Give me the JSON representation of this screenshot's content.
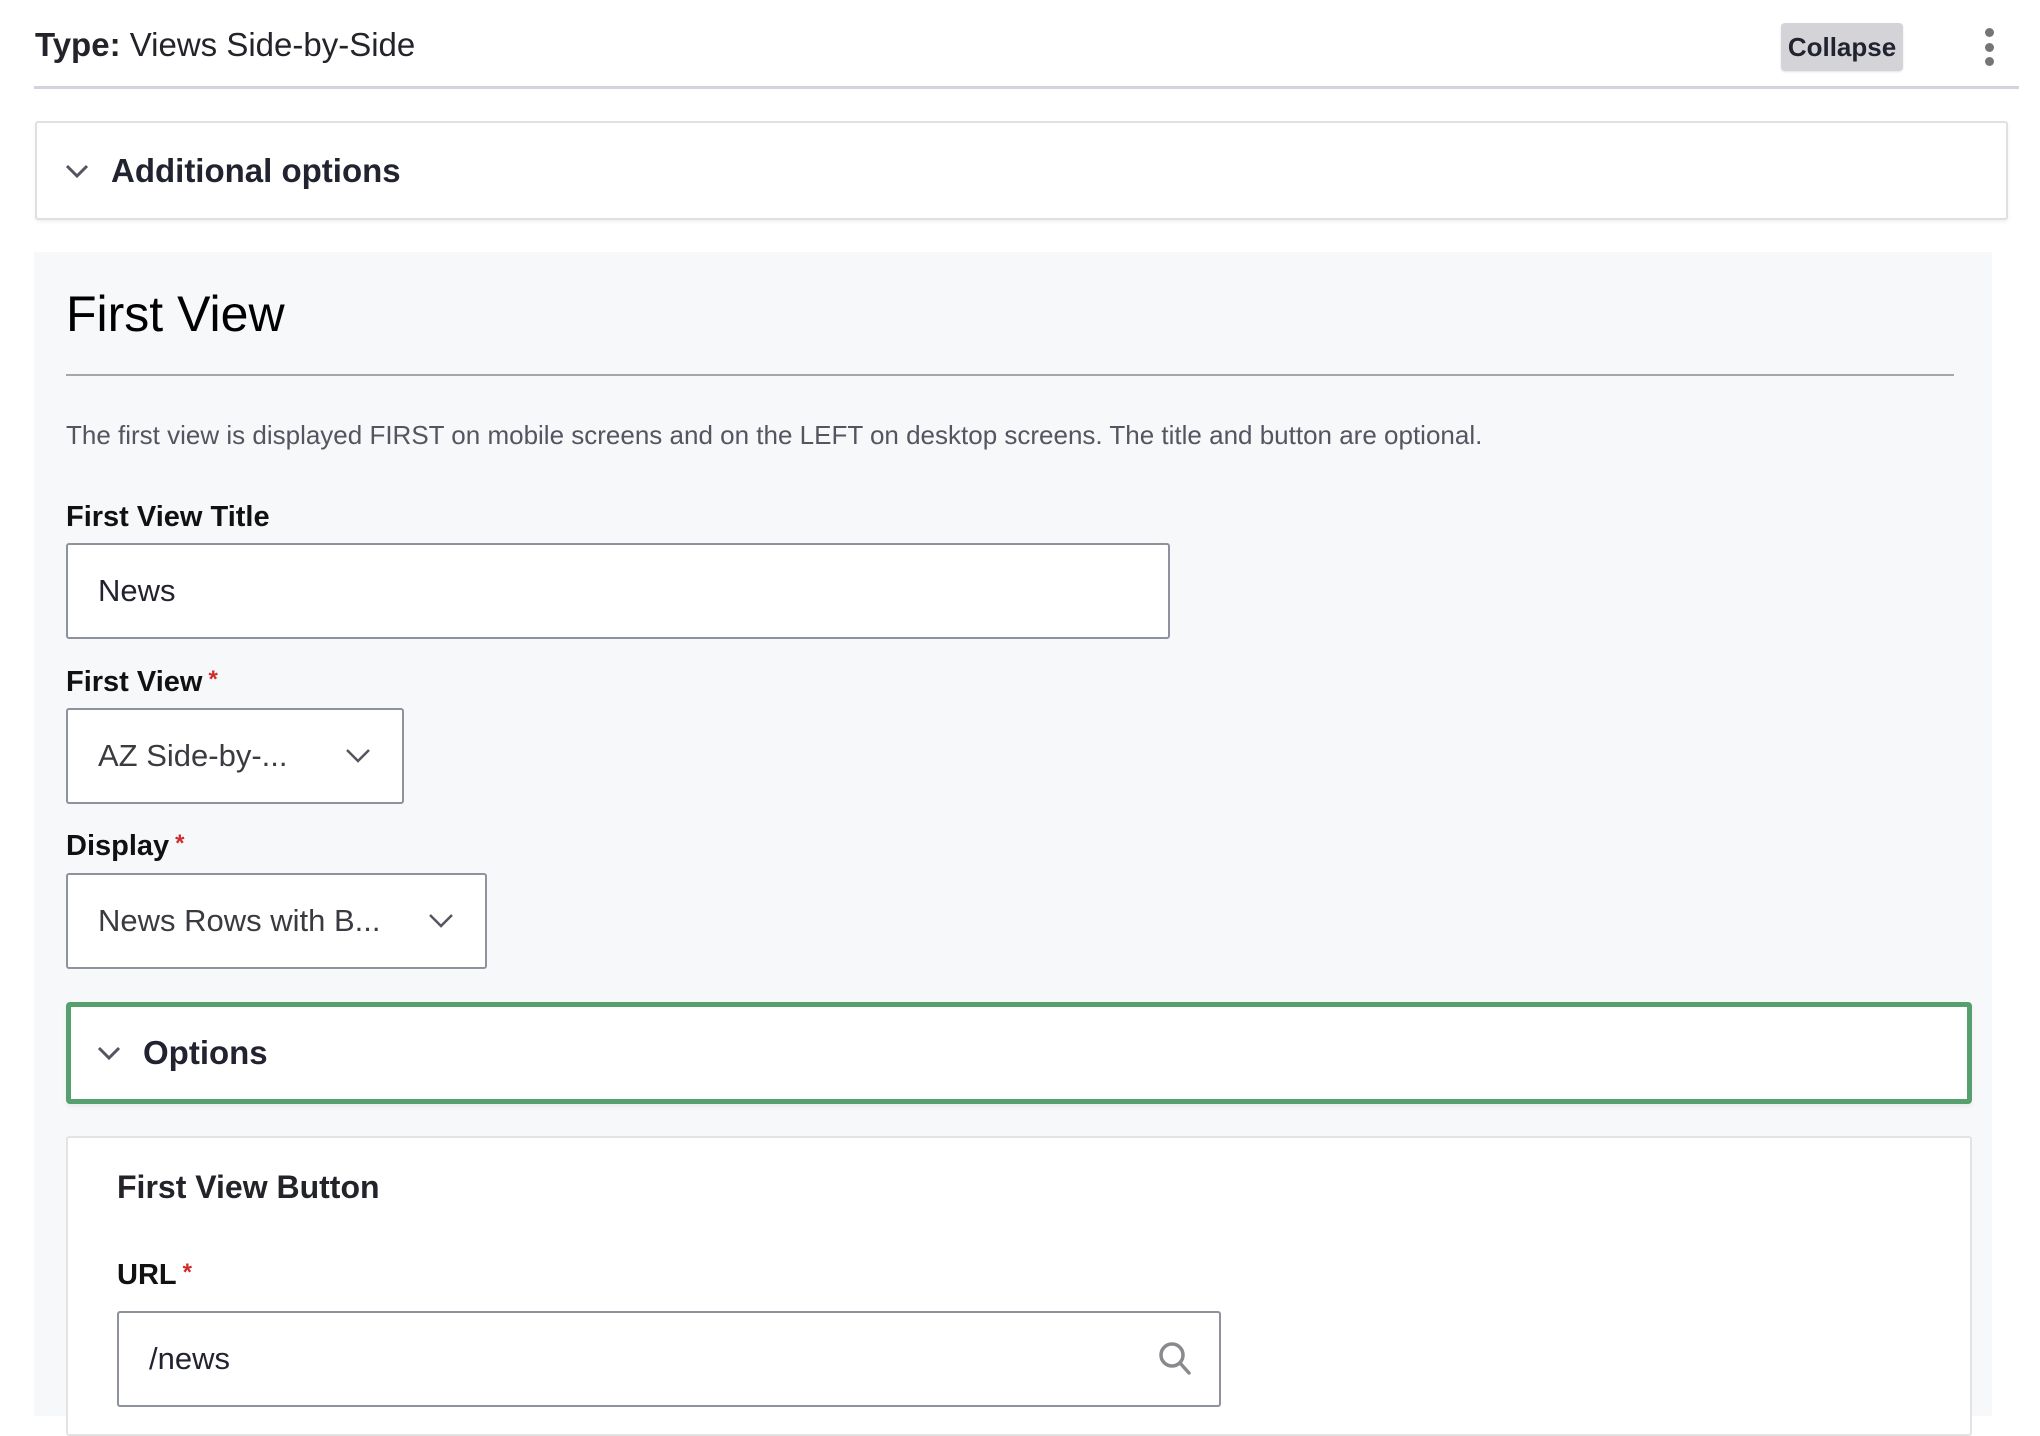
{
  "header": {
    "type_label": "Type:",
    "type_value": "Views Side-by-Side",
    "collapse_button": "Collapse",
    "more_icon": "kebab-vertical-icon"
  },
  "additional_options": {
    "label": "Additional options",
    "icon": "chevron-down-icon"
  },
  "first_view_panel": {
    "heading": "First View",
    "description": "The first view is displayed FIRST on mobile screens and on the LEFT on desktop screens. The title and button are optional.",
    "title_field": {
      "label": "First View Title",
      "value": "News"
    },
    "view_select": {
      "label": "First View",
      "required_marker": "*",
      "selected": "AZ Side-by-..."
    },
    "display_select": {
      "label": "Display",
      "required_marker": "*",
      "selected": "News Rows with B..."
    },
    "options_toggle": {
      "label": "Options",
      "icon": "chevron-down-icon"
    },
    "button_group": {
      "heading": "First View Button",
      "url_field": {
        "label": "URL",
        "required_marker": "*",
        "value": "/news",
        "icon": "search-icon"
      }
    }
  },
  "colors": {
    "focus_border": "#55a06e",
    "required": "#d02c2c",
    "panel_background": "#f7f8fa",
    "collapse_button_bg": "#d4d4d8"
  }
}
